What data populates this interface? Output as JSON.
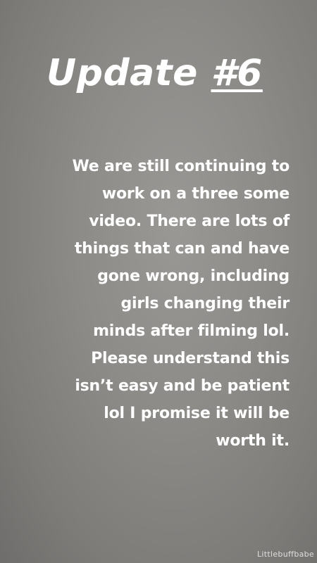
{
  "story": {
    "title_prefix": "Update ",
    "title_number": "#6",
    "message_lines": [
      "We are still continuing to",
      "work on a three some",
      "video. There are lots of",
      "things that can and have",
      "gone wrong, including",
      "girls changing their",
      "minds after filming lol.",
      "Please understand this",
      "isn’t easy and be patient",
      "lol I promise it will be",
      "worth it."
    ],
    "watermark": "Littlebuffbabe"
  },
  "colors": {
    "background": "#8d8b88",
    "text": "#ffffff"
  }
}
